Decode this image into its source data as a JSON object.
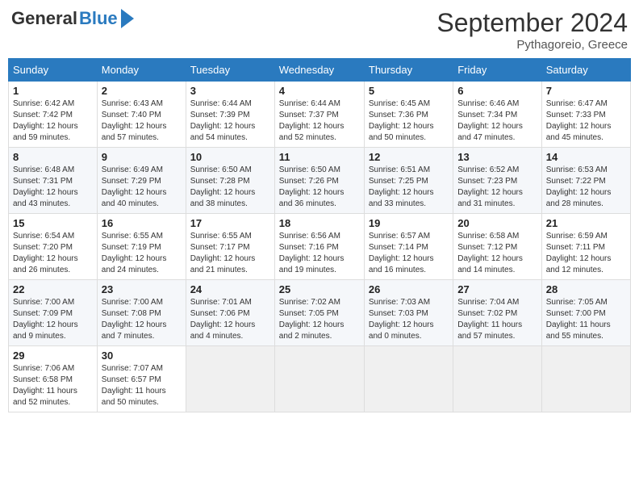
{
  "header": {
    "logo_part1": "General",
    "logo_part2": "Blue",
    "month_year": "September 2024",
    "location": "Pythagoreio, Greece"
  },
  "weekdays": [
    "Sunday",
    "Monday",
    "Tuesday",
    "Wednesday",
    "Thursday",
    "Friday",
    "Saturday"
  ],
  "weeks": [
    [
      {
        "day": "1",
        "sunrise": "6:42 AM",
        "sunset": "7:42 PM",
        "daylight_h": "12",
        "daylight_m": "59"
      },
      {
        "day": "2",
        "sunrise": "6:43 AM",
        "sunset": "7:40 PM",
        "daylight_h": "12",
        "daylight_m": "57"
      },
      {
        "day": "3",
        "sunrise": "6:44 AM",
        "sunset": "7:39 PM",
        "daylight_h": "12",
        "daylight_m": "54"
      },
      {
        "day": "4",
        "sunrise": "6:44 AM",
        "sunset": "7:37 PM",
        "daylight_h": "12",
        "daylight_m": "52"
      },
      {
        "day": "5",
        "sunrise": "6:45 AM",
        "sunset": "7:36 PM",
        "daylight_h": "12",
        "daylight_m": "50"
      },
      {
        "day": "6",
        "sunrise": "6:46 AM",
        "sunset": "7:34 PM",
        "daylight_h": "12",
        "daylight_m": "47"
      },
      {
        "day": "7",
        "sunrise": "6:47 AM",
        "sunset": "7:33 PM",
        "daylight_h": "12",
        "daylight_m": "45"
      }
    ],
    [
      {
        "day": "8",
        "sunrise": "6:48 AM",
        "sunset": "7:31 PM",
        "daylight_h": "12",
        "daylight_m": "43"
      },
      {
        "day": "9",
        "sunrise": "6:49 AM",
        "sunset": "7:29 PM",
        "daylight_h": "12",
        "daylight_m": "40"
      },
      {
        "day": "10",
        "sunrise": "6:50 AM",
        "sunset": "7:28 PM",
        "daylight_h": "12",
        "daylight_m": "38"
      },
      {
        "day": "11",
        "sunrise": "6:50 AM",
        "sunset": "7:26 PM",
        "daylight_h": "12",
        "daylight_m": "36"
      },
      {
        "day": "12",
        "sunrise": "6:51 AM",
        "sunset": "7:25 PM",
        "daylight_h": "12",
        "daylight_m": "33"
      },
      {
        "day": "13",
        "sunrise": "6:52 AM",
        "sunset": "7:23 PM",
        "daylight_h": "12",
        "daylight_m": "31"
      },
      {
        "day": "14",
        "sunrise": "6:53 AM",
        "sunset": "7:22 PM",
        "daylight_h": "12",
        "daylight_m": "28"
      }
    ],
    [
      {
        "day": "15",
        "sunrise": "6:54 AM",
        "sunset": "7:20 PM",
        "daylight_h": "12",
        "daylight_m": "26"
      },
      {
        "day": "16",
        "sunrise": "6:55 AM",
        "sunset": "7:19 PM",
        "daylight_h": "12",
        "daylight_m": "24"
      },
      {
        "day": "17",
        "sunrise": "6:55 AM",
        "sunset": "7:17 PM",
        "daylight_h": "12",
        "daylight_m": "21"
      },
      {
        "day": "18",
        "sunrise": "6:56 AM",
        "sunset": "7:16 PM",
        "daylight_h": "12",
        "daylight_m": "19"
      },
      {
        "day": "19",
        "sunrise": "6:57 AM",
        "sunset": "7:14 PM",
        "daylight_h": "12",
        "daylight_m": "16"
      },
      {
        "day": "20",
        "sunrise": "6:58 AM",
        "sunset": "7:12 PM",
        "daylight_h": "12",
        "daylight_m": "14"
      },
      {
        "day": "21",
        "sunrise": "6:59 AM",
        "sunset": "7:11 PM",
        "daylight_h": "12",
        "daylight_m": "12"
      }
    ],
    [
      {
        "day": "22",
        "sunrise": "7:00 AM",
        "sunset": "7:09 PM",
        "daylight_h": "12",
        "daylight_m": "9"
      },
      {
        "day": "23",
        "sunrise": "7:00 AM",
        "sunset": "7:08 PM",
        "daylight_h": "12",
        "daylight_m": "7"
      },
      {
        "day": "24",
        "sunrise": "7:01 AM",
        "sunset": "7:06 PM",
        "daylight_h": "12",
        "daylight_m": "4"
      },
      {
        "day": "25",
        "sunrise": "7:02 AM",
        "sunset": "7:05 PM",
        "daylight_h": "12",
        "daylight_m": "2"
      },
      {
        "day": "26",
        "sunrise": "7:03 AM",
        "sunset": "7:03 PM",
        "daylight_h": "12",
        "daylight_m": "0"
      },
      {
        "day": "27",
        "sunrise": "7:04 AM",
        "sunset": "7:02 PM",
        "daylight_h": "11",
        "daylight_m": "57"
      },
      {
        "day": "28",
        "sunrise": "7:05 AM",
        "sunset": "7:00 PM",
        "daylight_h": "11",
        "daylight_m": "55"
      }
    ],
    [
      {
        "day": "29",
        "sunrise": "7:06 AM",
        "sunset": "6:58 PM",
        "daylight_h": "11",
        "daylight_m": "52"
      },
      {
        "day": "30",
        "sunrise": "7:07 AM",
        "sunset": "6:57 PM",
        "daylight_h": "11",
        "daylight_m": "50"
      },
      null,
      null,
      null,
      null,
      null
    ]
  ],
  "labels": {
    "sunrise": "Sunrise:",
    "sunset": "Sunset:",
    "daylight": "Daylight:"
  }
}
